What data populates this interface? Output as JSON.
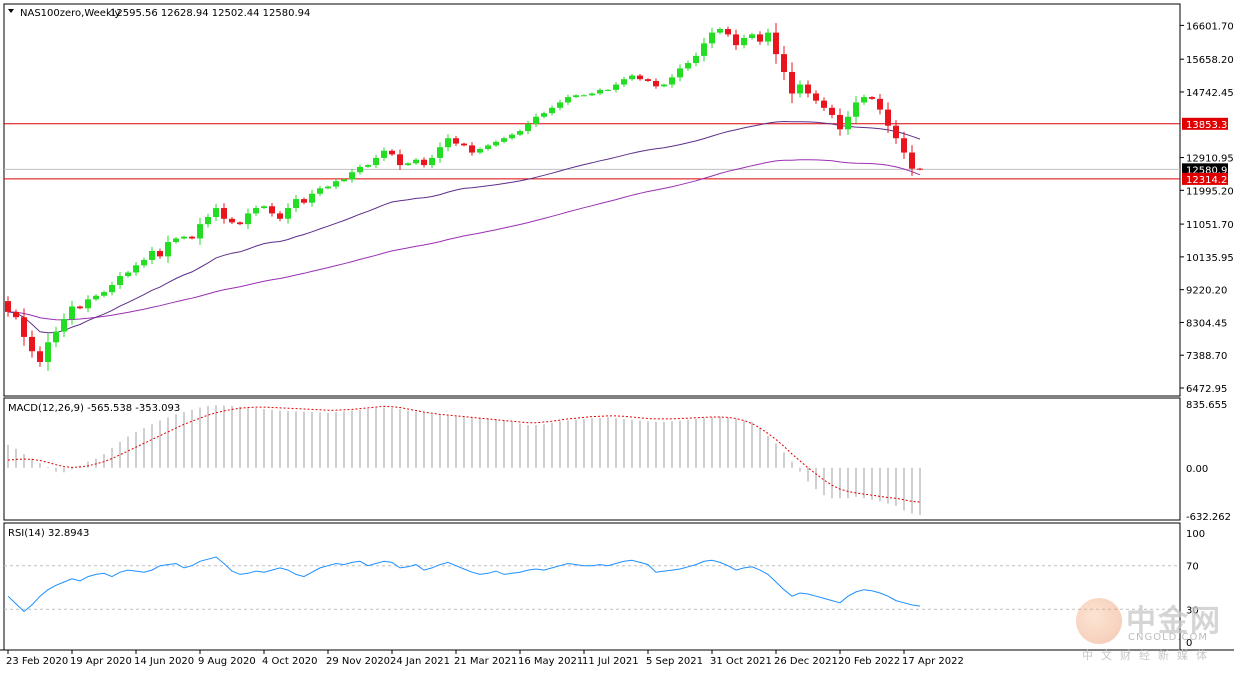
{
  "symbol": {
    "title": "NAS100zero,Weekly",
    "ohlc": "12595.56 12628.94 12502.44 12580.94"
  },
  "chart_data": [
    {
      "type": "candlestick",
      "title": "NAS100zero,Weekly",
      "ylim": [
        6472.95,
        17200
      ],
      "y_ticks": [
        "16601.70",
        "15658.20",
        "14742.45",
        "13853.35",
        "12910.95",
        "12580.94",
        "12314.27",
        "11995.20",
        "11051.70",
        "10135.95",
        "9220.20",
        "8304.45",
        "7388.70",
        "6472.95"
      ],
      "price_labels": [
        {
          "value": 13853.35,
          "text": "13853.35",
          "color": "#e00000"
        },
        {
          "value": 12580.94,
          "text": "12580.94",
          "color": "#000000"
        },
        {
          "value": 12314.27,
          "text": "12314.27",
          "color": "#e00000"
        }
      ],
      "horizontal_lines": [
        {
          "value": 13853.35,
          "color": "#e00000"
        },
        {
          "value": 12314.27,
          "color": "#e00000"
        },
        {
          "value": 12580.94,
          "color": "#c0c0c0"
        }
      ],
      "x_labels": [
        "23 Feb 2020",
        "19 Apr 2020",
        "14 Jun 2020",
        "9 Aug 2020",
        "4 Oct 2020",
        "29 Nov 2020",
        "24 Jan 2021",
        "21 Mar 2021",
        "16 May 2021",
        "11 Jul 2021",
        "5 Sep 2021",
        "31 Oct 2021",
        "26 Dec 2021",
        "20 Feb 2022",
        "17 Apr 2022"
      ],
      "x_label_bar_index": [
        0,
        8,
        16,
        24,
        32,
        40,
        48,
        56,
        64,
        72,
        80,
        88,
        96,
        104,
        112
      ],
      "closes": [
        8600,
        8450,
        7900,
        7500,
        7200,
        7750,
        8050,
        8400,
        8750,
        8700,
        8950,
        9050,
        9150,
        9350,
        9600,
        9700,
        9900,
        10050,
        10300,
        10150,
        10550,
        10650,
        10700,
        10650,
        11050,
        11250,
        11500,
        11200,
        11100,
        11050,
        11350,
        11500,
        11550,
        11350,
        11200,
        11500,
        11750,
        11650,
        11900,
        12050,
        12100,
        12250,
        12300,
        12500,
        12650,
        12700,
        12900,
        13100,
        13000,
        12700,
        12750,
        12850,
        12700,
        12900,
        13200,
        13450,
        13300,
        13250,
        13050,
        13150,
        13250,
        13350,
        13450,
        13550,
        13650,
        13850,
        14050,
        14150,
        14300,
        14450,
        14600,
        14650,
        14650,
        14700,
        14800,
        14800,
        14950,
        15100,
        15200,
        15100,
        15050,
        14900,
        14950,
        15150,
        15400,
        15550,
        15750,
        16100,
        16400,
        16500,
        16350,
        16050,
        16250,
        16350,
        16150,
        16400,
        15800,
        15300,
        14700,
        14950,
        14700,
        14500,
        14300,
        14100,
        13700,
        14050,
        14450,
        14600,
        14550,
        14250,
        13800,
        13450,
        13050,
        12600,
        12580.94
      ],
      "ema_fast": [
        8600,
        8570,
        8446,
        8256,
        8044,
        8015,
        8022,
        8077,
        8175,
        8247,
        8357,
        8451,
        8538,
        8641,
        8760,
        8863,
        8971,
        9081,
        9202,
        9292,
        9415,
        9531,
        9632,
        9716,
        9839,
        9968,
        10106,
        10180,
        10238,
        10279,
        10354,
        10436,
        10507,
        10546,
        10565,
        10621,
        10702,
        10760,
        10837,
        10917,
        10994,
        11074,
        11151,
        11240,
        11330,
        11409,
        11498,
        11592,
        11668,
        11704,
        11734,
        11770,
        11788,
        11822,
        11875,
        11946,
        12003,
        12050,
        12069,
        12094,
        12122,
        12152,
        12186,
        12221,
        12258,
        12304,
        12359,
        12414,
        12473,
        12535,
        12600,
        12659,
        12713,
        12765,
        12819,
        12868,
        12921,
        12977,
        13032,
        13079,
        13122,
        13154,
        13186,
        13225,
        13272,
        13322,
        13377,
        13441,
        13509,
        13577,
        13638,
        13689,
        13738,
        13786,
        13828,
        13874,
        13904,
        13918,
        13913,
        13913,
        13906,
        13894,
        13874,
        13848,
        13807,
        13780,
        13762,
        13750,
        13737,
        13716,
        13682,
        13638,
        13580,
        13505,
        13425
      ],
      "ema_slow": [
        8600,
        8590,
        8553,
        8500,
        8438,
        8404,
        8381,
        8374,
        8387,
        8400,
        8421,
        8445,
        8472,
        8504,
        8546,
        8586,
        8630,
        8675,
        8725,
        8772,
        8828,
        8883,
        8935,
        8982,
        9041,
        9102,
        9167,
        9217,
        9262,
        9303,
        9354,
        9407,
        9457,
        9498,
        9532,
        9577,
        9630,
        9677,
        9730,
        9784,
        9837,
        9891,
        9945,
        10004,
        10064,
        10121,
        10181,
        10244,
        10302,
        10346,
        10388,
        10432,
        10469,
        10512,
        10564,
        10621,
        10672,
        10721,
        10761,
        10804,
        10848,
        10894,
        10942,
        10991,
        11041,
        11094,
        11151,
        11208,
        11268,
        11329,
        11392,
        11452,
        11509,
        11566,
        11624,
        11679,
        11737,
        11797,
        11857,
        11911,
        11961,
        12004,
        12049,
        12096,
        12149,
        12204,
        12262,
        12327,
        12396,
        12465,
        12526,
        12577,
        12631,
        12684,
        12731,
        12782,
        12816,
        12835,
        12836,
        12848,
        12850,
        12846,
        12835,
        12819,
        12787,
        12765,
        12753,
        12747,
        12741,
        12725,
        12693,
        12650,
        12592,
        12515,
        12430
      ]
    },
    {
      "type": "bar+line",
      "title": "MACD(12,26,9) -565.538 -353.093",
      "ylim": [
        -632.262,
        835.655
      ],
      "y_ticks": [
        "835.655",
        "0.00",
        "-632.262"
      ],
      "histogram": [
        300,
        250,
        180,
        120,
        60,
        10,
        -50,
        -60,
        -20,
        30,
        80,
        120,
        180,
        260,
        340,
        410,
        470,
        520,
        570,
        620,
        660,
        700,
        730,
        760,
        790,
        810,
        820,
        815,
        810,
        800,
        790,
        780,
        770,
        760,
        750,
        745,
        740,
        735,
        730,
        725,
        720,
        730,
        740,
        750,
        760,
        770,
        780,
        790,
        785,
        770,
        750,
        735,
        720,
        700,
        690,
        680,
        670,
        665,
        660,
        655,
        650,
        640,
        620,
        600,
        580,
        560,
        560,
        570,
        590,
        610,
        620,
        630,
        640,
        650,
        655,
        660,
        650,
        640,
        630,
        620,
        610,
        600,
        600,
        610,
        620,
        630,
        640,
        650,
        660,
        670,
        660,
        640,
        620,
        600,
        520,
        420,
        320,
        200,
        80,
        -50,
        -180,
        -280,
        -360,
        -400,
        -400,
        -400,
        -380,
        -400,
        -420,
        -440,
        -470,
        -500,
        -560,
        -600,
        -620
      ],
      "signal": [
        100,
        110,
        115,
        110,
        95,
        70,
        40,
        15,
        5,
        10,
        25,
        50,
        80,
        120,
        170,
        220,
        270,
        320,
        370,
        420,
        470,
        520,
        570,
        610,
        650,
        690,
        720,
        745,
        765,
        780,
        790,
        795,
        795,
        790,
        785,
        780,
        775,
        770,
        765,
        760,
        755,
        755,
        760,
        765,
        775,
        785,
        795,
        805,
        800,
        790,
        770,
        750,
        730,
        715,
        700,
        690,
        680,
        670,
        660,
        650,
        640,
        630,
        620,
        610,
        600,
        590,
        590,
        600,
        610,
        625,
        640,
        650,
        660,
        670,
        675,
        680,
        680,
        675,
        665,
        655,
        645,
        640,
        640,
        640,
        645,
        650,
        655,
        660,
        665,
        665,
        660,
        645,
        620,
        580,
        520,
        450,
        370,
        280,
        180,
        90,
        0,
        -80,
        -160,
        -230,
        -280,
        -310,
        -330,
        -345,
        -360,
        -375,
        -390,
        -400,
        -420,
        -440,
        -450
      ]
    },
    {
      "type": "line",
      "title": "RSI(14) 32.8943",
      "ylim": [
        0,
        100
      ],
      "y_ticks": [
        "100",
        "70",
        "30",
        "0"
      ],
      "levels": [
        70,
        30
      ],
      "values": [
        42,
        35,
        28,
        34,
        42,
        48,
        52,
        55,
        58,
        56,
        60,
        62,
        63,
        60,
        64,
        66,
        65,
        64,
        66,
        70,
        71,
        72,
        68,
        70,
        74,
        76,
        78,
        72,
        65,
        62,
        63,
        65,
        64,
        66,
        68,
        66,
        62,
        60,
        64,
        68,
        70,
        72,
        71,
        73,
        74,
        70,
        72,
        74,
        73,
        68,
        69,
        71,
        66,
        68,
        71,
        73,
        70,
        67,
        64,
        62,
        63,
        65,
        62,
        63,
        64,
        66,
        67,
        66,
        68,
        70,
        72,
        71,
        70,
        70,
        71,
        70,
        72,
        74,
        75,
        73,
        71,
        64,
        65,
        66,
        67,
        69,
        71,
        74,
        75,
        73,
        70,
        66,
        68,
        69,
        66,
        62,
        55,
        48,
        42,
        45,
        44,
        42,
        40,
        38,
        36,
        42,
        46,
        48,
        47,
        45,
        42,
        38,
        36,
        34,
        32.89
      ]
    }
  ],
  "watermark": {
    "brand": "中金网",
    "url": "CNGOLD.COM",
    "tagline": "中文财经新媒体"
  }
}
